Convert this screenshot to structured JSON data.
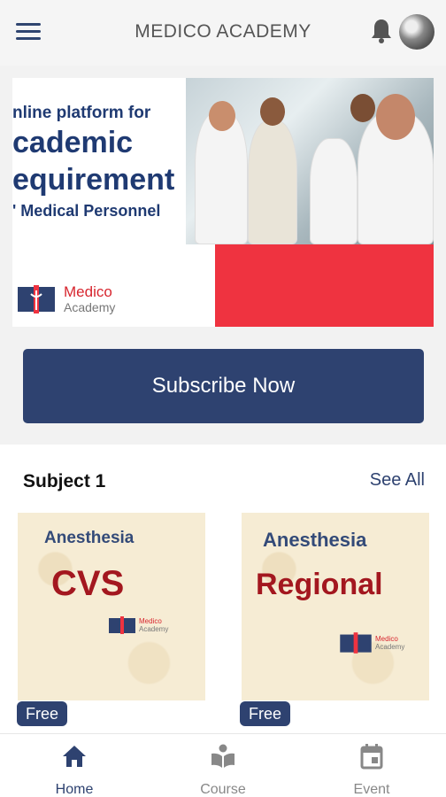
{
  "app": {
    "title": "MEDICO ACADEMY"
  },
  "header": {
    "menu_icon": "menu-icon",
    "notification_icon": "bell-icon",
    "avatar_icon": "avatar-image"
  },
  "banner": {
    "line1": "nline platform for",
    "line2": "cademic",
    "line3": "equirement",
    "line4": "' Medical Personnel",
    "logo_name": "Medico",
    "logo_sub": "Academy",
    "accent_color": "#ef3340",
    "text_color": "#1f3a72"
  },
  "subscribe": {
    "label": "Subscribe Now"
  },
  "section": {
    "title": "Subject 1",
    "see_all": "See All",
    "cards": [
      {
        "subject": "Anesthesia",
        "topic": "CVS",
        "badge": "Free",
        "logo_name": "Medico",
        "logo_sub": "Academy"
      },
      {
        "subject": "Anesthesia",
        "topic": "Regional",
        "badge": "Free",
        "logo_name": "Medico",
        "logo_sub": "Academy"
      }
    ]
  },
  "bottom_nav": {
    "items": [
      {
        "label": "Home",
        "icon": "home-icon",
        "active": true
      },
      {
        "label": "Course",
        "icon": "book-reader-icon",
        "active": false
      },
      {
        "label": "Event",
        "icon": "calendar-icon",
        "active": false
      }
    ]
  },
  "colors": {
    "primary": "#2e4270",
    "card_bg": "#f6ecd4",
    "topic_red": "#a3171f"
  }
}
